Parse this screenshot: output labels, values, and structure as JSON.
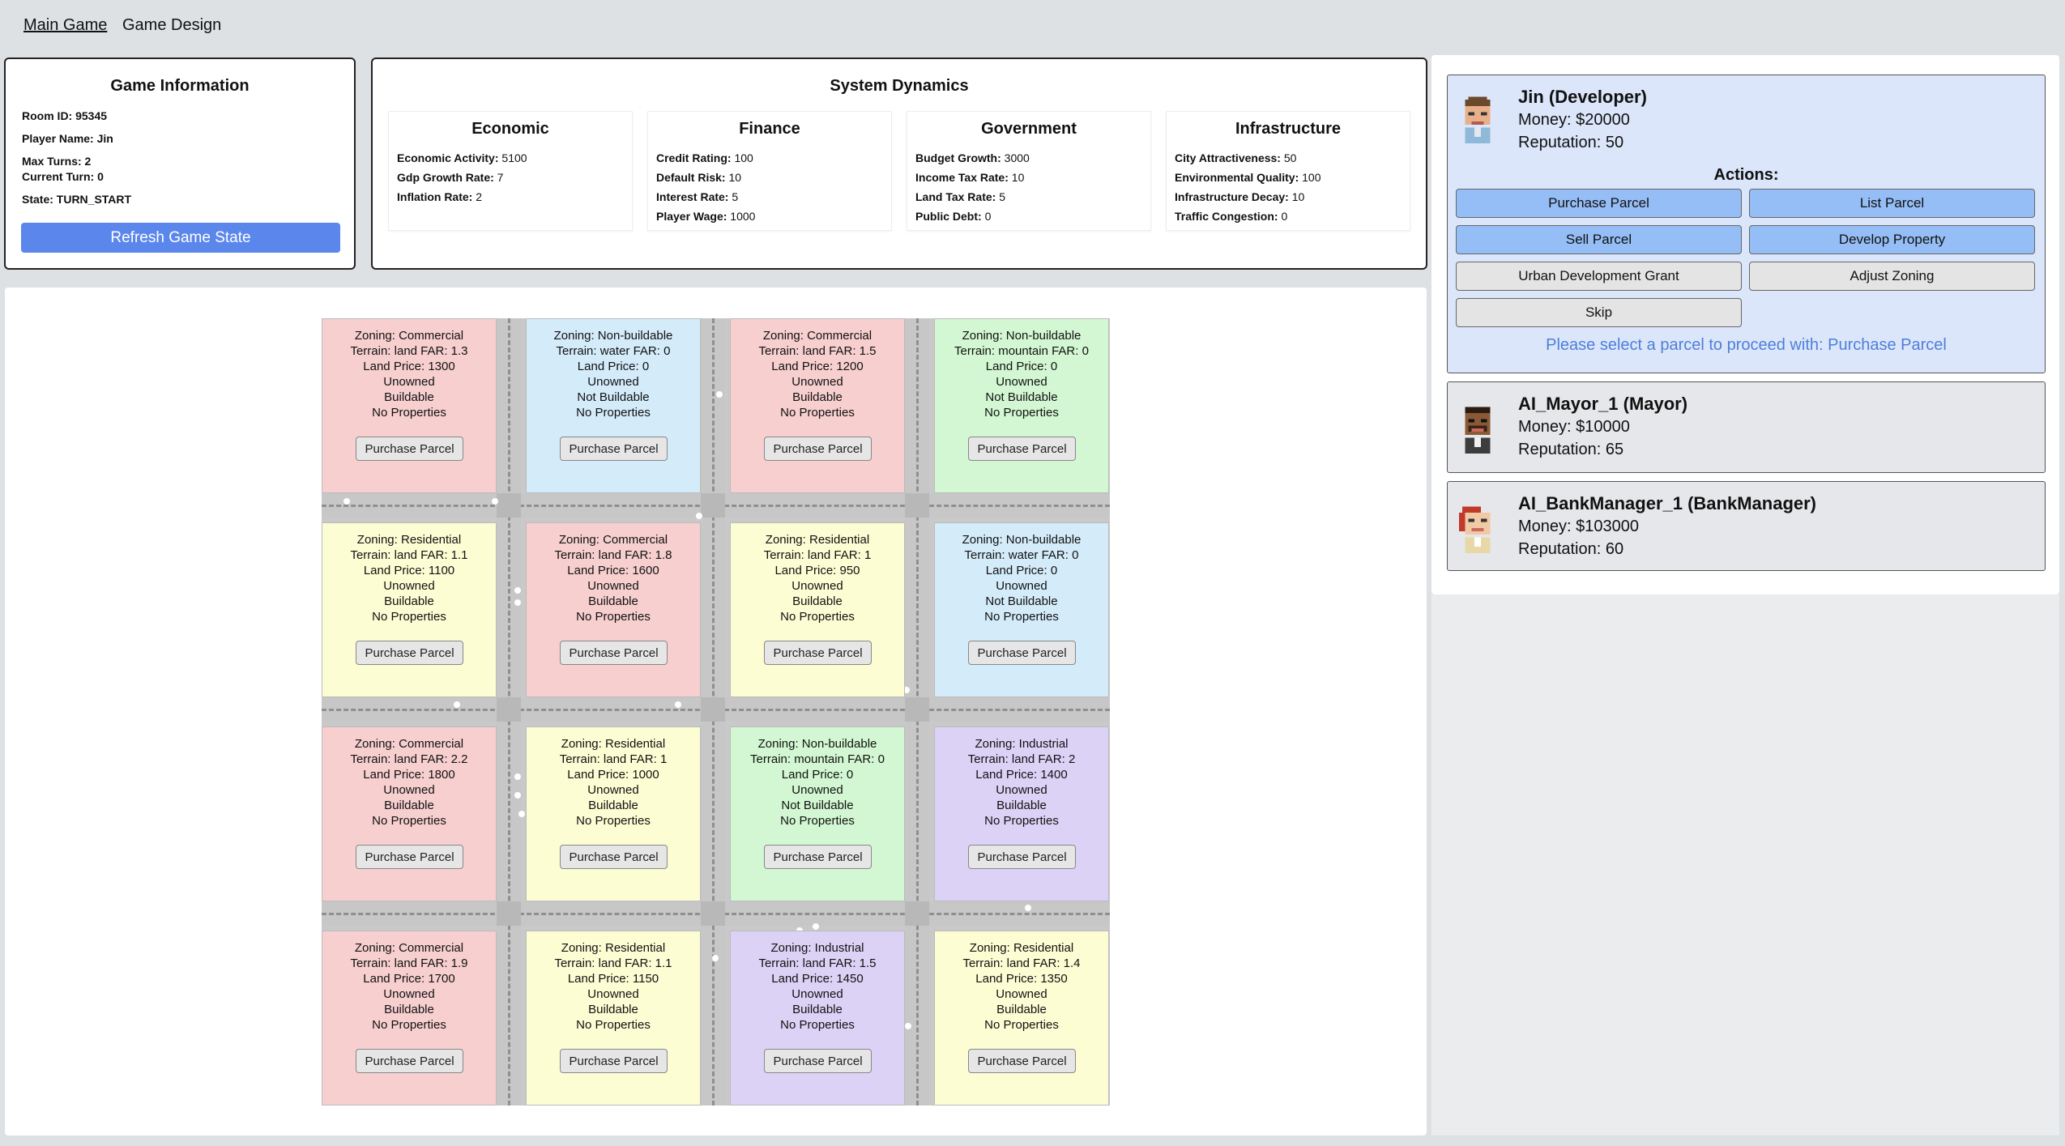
{
  "nav": {
    "main_game": "Main Game",
    "game_design": "Game Design"
  },
  "game_info": {
    "title": "Game Information",
    "room_id": "Room ID: 95345",
    "player_name": "Player Name: Jin",
    "max_turns": "Max Turns: 2",
    "current_turn": "Current Turn: 0",
    "state": "State: TURN_START",
    "refresh_label": "Refresh Game State"
  },
  "system_dynamics": {
    "title": "System Dynamics",
    "categories": [
      {
        "title": "Economic",
        "rows": [
          {
            "label": "Economic Activity:",
            "value": "5100"
          },
          {
            "label": "Gdp Growth Rate:",
            "value": "7"
          },
          {
            "label": "Inflation Rate:",
            "value": "2"
          }
        ]
      },
      {
        "title": "Finance",
        "rows": [
          {
            "label": "Credit Rating:",
            "value": "100"
          },
          {
            "label": "Default Risk:",
            "value": "10"
          },
          {
            "label": "Interest Rate:",
            "value": "5"
          },
          {
            "label": "Player Wage:",
            "value": "1000"
          }
        ]
      },
      {
        "title": "Government",
        "rows": [
          {
            "label": "Budget Growth:",
            "value": "3000"
          },
          {
            "label": "Income Tax Rate:",
            "value": "10"
          },
          {
            "label": "Land Tax Rate:",
            "value": "5"
          },
          {
            "label": "Public Debt:",
            "value": "0"
          }
        ]
      },
      {
        "title": "Infrastructure",
        "rows": [
          {
            "label": "City Attractiveness:",
            "value": "50"
          },
          {
            "label": "Environmental Quality:",
            "value": "100"
          },
          {
            "label": "Infrastructure Decay:",
            "value": "10"
          },
          {
            "label": "Traffic Congestion:",
            "value": "0"
          }
        ]
      }
    ]
  },
  "parcels": [
    {
      "zoning": "Zoning: Commercial",
      "terrain": "Terrain: land FAR: 1.3",
      "price": "Land Price: 1300",
      "owner": "Unowned",
      "build": "Buildable",
      "props": "No Properties",
      "button": "Purchase Parcel",
      "cls": "z-commercial"
    },
    {
      "zoning": "Zoning: Non-buildable",
      "terrain": "Terrain: water FAR: 0",
      "price": "Land Price: 0",
      "owner": "Unowned",
      "build": "Not Buildable",
      "props": "No Properties",
      "button": "Purchase Parcel",
      "cls": "z-nonbuildable-water"
    },
    {
      "zoning": "Zoning: Commercial",
      "terrain": "Terrain: land FAR: 1.5",
      "price": "Land Price: 1200",
      "owner": "Unowned",
      "build": "Buildable",
      "props": "No Properties",
      "button": "Purchase Parcel",
      "cls": "z-commercial"
    },
    {
      "zoning": "Zoning: Non-buildable",
      "terrain": "Terrain: mountain FAR: 0",
      "price": "Land Price: 0",
      "owner": "Unowned",
      "build": "Not Buildable",
      "props": "No Properties",
      "button": "Purchase Parcel",
      "cls": "z-nonbuildable-mountain"
    },
    {
      "zoning": "Zoning: Residential",
      "terrain": "Terrain: land FAR: 1.1",
      "price": "Land Price: 1100",
      "owner": "Unowned",
      "build": "Buildable",
      "props": "No Properties",
      "button": "Purchase Parcel",
      "cls": "z-residential"
    },
    {
      "zoning": "Zoning: Commercial",
      "terrain": "Terrain: land FAR: 1.8",
      "price": "Land Price: 1600",
      "owner": "Unowned",
      "build": "Buildable",
      "props": "No Properties",
      "button": "Purchase Parcel",
      "cls": "z-commercial"
    },
    {
      "zoning": "Zoning: Residential",
      "terrain": "Terrain: land FAR: 1",
      "price": "Land Price: 950",
      "owner": "Unowned",
      "build": "Buildable",
      "props": "No Properties",
      "button": "Purchase Parcel",
      "cls": "z-residential"
    },
    {
      "zoning": "Zoning: Non-buildable",
      "terrain": "Terrain: water FAR: 0",
      "price": "Land Price: 0",
      "owner": "Unowned",
      "build": "Not Buildable",
      "props": "No Properties",
      "button": "Purchase Parcel",
      "cls": "z-nonbuildable-water"
    },
    {
      "zoning": "Zoning: Commercial",
      "terrain": "Terrain: land FAR: 2.2",
      "price": "Land Price: 1800",
      "owner": "Unowned",
      "build": "Buildable",
      "props": "No Properties",
      "button": "Purchase Parcel",
      "cls": "z-commercial"
    },
    {
      "zoning": "Zoning: Residential",
      "terrain": "Terrain: land FAR: 1",
      "price": "Land Price: 1000",
      "owner": "Unowned",
      "build": "Buildable",
      "props": "No Properties",
      "button": "Purchase Parcel",
      "cls": "z-residential"
    },
    {
      "zoning": "Zoning: Non-buildable",
      "terrain": "Terrain: mountain FAR: 0",
      "price": "Land Price: 0",
      "owner": "Unowned",
      "build": "Not Buildable",
      "props": "No Properties",
      "button": "Purchase Parcel",
      "cls": "z-nonbuildable-mountain"
    },
    {
      "zoning": "Zoning: Industrial",
      "terrain": "Terrain: land FAR: 2",
      "price": "Land Price: 1400",
      "owner": "Unowned",
      "build": "Buildable",
      "props": "No Properties",
      "button": "Purchase Parcel",
      "cls": "z-industrial"
    },
    {
      "zoning": "Zoning: Commercial",
      "terrain": "Terrain: land FAR: 1.9",
      "price": "Land Price: 1700",
      "owner": "Unowned",
      "build": "Buildable",
      "props": "No Properties",
      "button": "Purchase Parcel",
      "cls": "z-commercial"
    },
    {
      "zoning": "Zoning: Residential",
      "terrain": "Terrain: land FAR: 1.1",
      "price": "Land Price: 1150",
      "owner": "Unowned",
      "build": "Buildable",
      "props": "No Properties",
      "button": "Purchase Parcel",
      "cls": "z-residential"
    },
    {
      "zoning": "Zoning: Industrial",
      "terrain": "Terrain: land FAR: 1.5",
      "price": "Land Price: 1450",
      "owner": "Unowned",
      "build": "Buildable",
      "props": "No Properties",
      "button": "Purchase Parcel",
      "cls": "z-industrial"
    },
    {
      "zoning": "Zoning: Residential",
      "terrain": "Terrain: land FAR: 1.4",
      "price": "Land Price: 1350",
      "owner": "Unowned",
      "build": "Buildable",
      "props": "No Properties",
      "button": "Purchase Parcel",
      "cls": "z-residential"
    }
  ],
  "players": [
    {
      "name": "Jin (Developer)",
      "money": "Money: $20000",
      "reputation": "Reputation: 50",
      "avatar": "developer-avatar-icon"
    },
    {
      "name": "AI_Mayor_1 (Mayor)",
      "money": "Money: $10000",
      "reputation": "Reputation: 65",
      "avatar": "mayor-avatar-icon"
    },
    {
      "name": "AI_BankManager_1 (BankManager)",
      "money": "Money: $103000",
      "reputation": "Reputation: 60",
      "avatar": "bankmanager-avatar-icon"
    }
  ],
  "actions": {
    "title": "Actions:",
    "purchase_parcel": "Purchase Parcel",
    "list_parcel": "List Parcel",
    "sell_parcel": "Sell Parcel",
    "develop_property": "Develop Property",
    "urban_grant": "Urban Development Grant",
    "adjust_zoning": "Adjust Zoning",
    "skip": "Skip",
    "status": "Please select a parcel to proceed with: Purchase Parcel"
  },
  "colors": {
    "accent_blue": "#5b87ec",
    "action_blue": "#95bdf6",
    "status_text": "#4e7fd8",
    "commercial": "#f7cfcf",
    "residential": "#fdfdd4",
    "industrial": "#dcd2f6",
    "water": "#d4ebfa",
    "mountain": "#d2f7d2"
  }
}
